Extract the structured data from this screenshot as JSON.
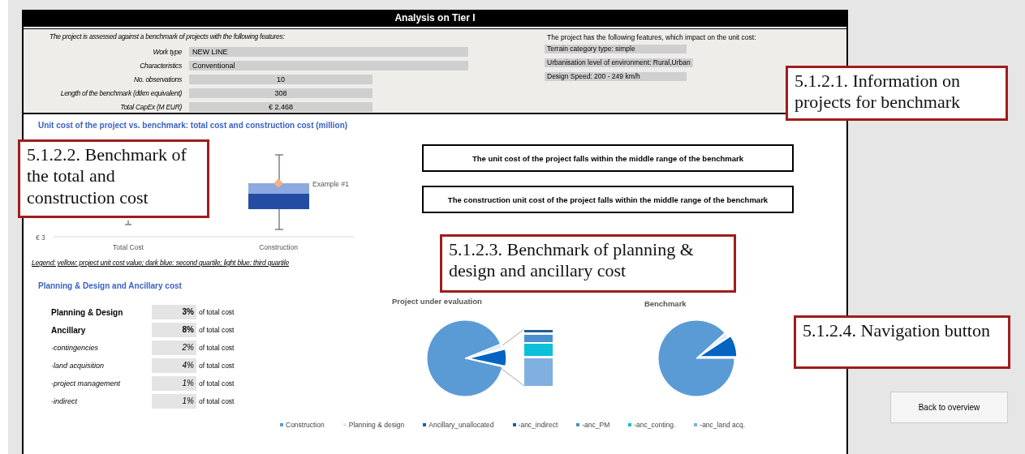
{
  "title": "Analysis on Tier I",
  "benchmark_features": {
    "intro": "The project is assessed against a benchmark of projects with the following features:",
    "rows": [
      {
        "label": "Work type",
        "value": "NEW LINE",
        "kind": "text"
      },
      {
        "label": "Characteristics",
        "value": "Conventional",
        "kind": "text"
      },
      {
        "label": "No. observations",
        "value": "10",
        "kind": "number"
      },
      {
        "label": "Length of the benchmark (dtkm equivalent)",
        "value": "308",
        "kind": "number"
      },
      {
        "label": "Total CapEx (M EUR)",
        "value": "€ 2.468",
        "kind": "number"
      }
    ]
  },
  "project_features": {
    "intro": "The project has the following features, which impact on the unit cost:",
    "items": [
      "Terrain category type:  simple",
      "Urbanisation level of environment:  Rural,Urban",
      "Design Speed:  200 - 249 km/h"
    ]
  },
  "unit_cost": {
    "heading": "Unit cost of the project vs. benchmark: total cost and construction cost (million)",
    "chart": {
      "y_tick": "€ 3",
      "categories": [
        "Total Cost",
        "Construction"
      ],
      "point_label": "Example #1"
    },
    "statements": [
      "The unit cost of the project falls within the middle range of the benchmark",
      "The construction unit cost of the project falls within the middle range of the benchmark"
    ],
    "legend_note": "Legend:  yellow: project unit cost value; dark blue: second quartile; light blue: third quartile"
  },
  "planning": {
    "heading": "Planning & Design and Ancillary cost",
    "rows": [
      {
        "label": "Planning & Design",
        "value": "3%",
        "suffix": "of total cost",
        "kind": "main"
      },
      {
        "label": "Ancillary",
        "value": "8%",
        "suffix": "of total cost",
        "kind": "main"
      },
      {
        "label": "-contingencies",
        "value": "2%",
        "suffix": "of total cost",
        "kind": "sub"
      },
      {
        "label": "-land acquisition",
        "value": "4%",
        "suffix": "of total cost",
        "kind": "sub"
      },
      {
        "label": "-project management",
        "value": "1%",
        "suffix": "of total cost",
        "kind": "sub"
      },
      {
        "label": "-indirect",
        "value": "1%",
        "suffix": "of total cost",
        "kind": "sub"
      }
    ],
    "pie_titles": [
      "Project under evaluation",
      "Benchmark"
    ],
    "legend": [
      {
        "label": "Construction",
        "color": "#5b9bd5"
      },
      {
        "label": "Planning & design",
        "color": "#deebf7"
      },
      {
        "label": "Ancillary_unallocated",
        "color": "#0563c1"
      },
      {
        "label": "-anc_indirect",
        "color": "#255e91"
      },
      {
        "label": "-anc_PM",
        "color": "#4a90d0"
      },
      {
        "label": "-anc_conting.",
        "color": "#0bc0d8"
      },
      {
        "label": "-anc_land acq.",
        "color": "#7fb0e0"
      }
    ]
  },
  "back_button": "Back to overview",
  "callouts": [
    "5.1.2.1. Information on projects for benchmark",
    "5.1.2.2. Benchmark of the total and construction cost",
    "5.1.2.3. Benchmark of planning & design and ancillary cost",
    "5.1.2.4. Navigation button"
  ]
}
